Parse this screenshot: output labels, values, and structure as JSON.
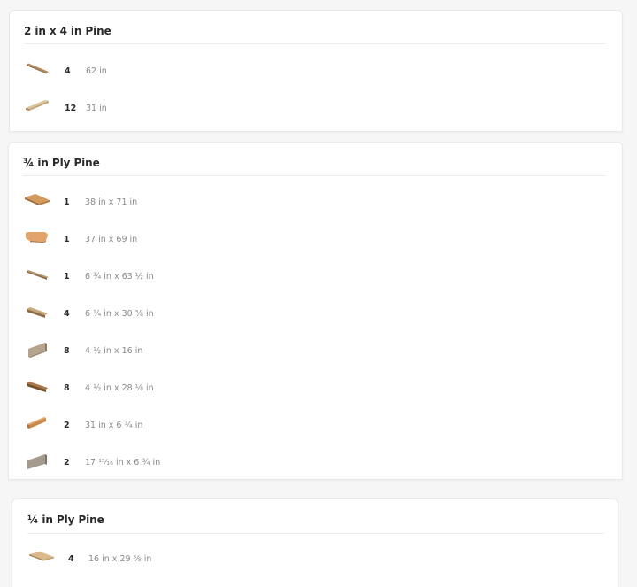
{
  "colors": {
    "page_background": "#f6f6f6",
    "card_background": "#ffffff",
    "title_text": "#2a2a2a",
    "dims_text": "#8a8a8a"
  },
  "groups": [
    {
      "title": "2 in x 4 in Pine",
      "parts": [
        {
          "icon": "thin-stick-icon",
          "qty": "4",
          "dims": "62 in"
        },
        {
          "icon": "flat-board-icon",
          "qty": "12",
          "dims": "31 in"
        }
      ]
    },
    {
      "title": "¾ in Ply Pine",
      "parts": [
        {
          "icon": "large-panel-icon",
          "qty": "1",
          "dims": "38 in x 71 in"
        },
        {
          "icon": "rounded-panel-icon",
          "qty": "1",
          "dims": "37 in x 69 in"
        },
        {
          "icon": "thin-strip-icon",
          "qty": "1",
          "dims": "6 ¾ in x 63 ½ in"
        },
        {
          "icon": "narrow-strip-icon",
          "qty": "4",
          "dims": "6 ¼ in x 30 ⅝ in"
        },
        {
          "icon": "short-side-panel-icon",
          "qty": "8",
          "dims": "4 ½ in x 16 in"
        },
        {
          "icon": "dark-strip-icon",
          "qty": "8",
          "dims": "4 ½ in x 28 ⅛ in"
        },
        {
          "icon": "orange-strip-icon",
          "qty": "2",
          "dims": "31 in x 6 ¾ in"
        },
        {
          "icon": "grey-side-panel-icon",
          "qty": "2",
          "dims": "17 ¹⁵⁄₁₆ in x 6 ¾ in"
        }
      ]
    },
    {
      "title": "¼ in Ply Pine",
      "parts": [
        {
          "icon": "thin-panel-icon",
          "qty": "4",
          "dims": "16 in x 29 ⅝ in"
        }
      ]
    }
  ]
}
